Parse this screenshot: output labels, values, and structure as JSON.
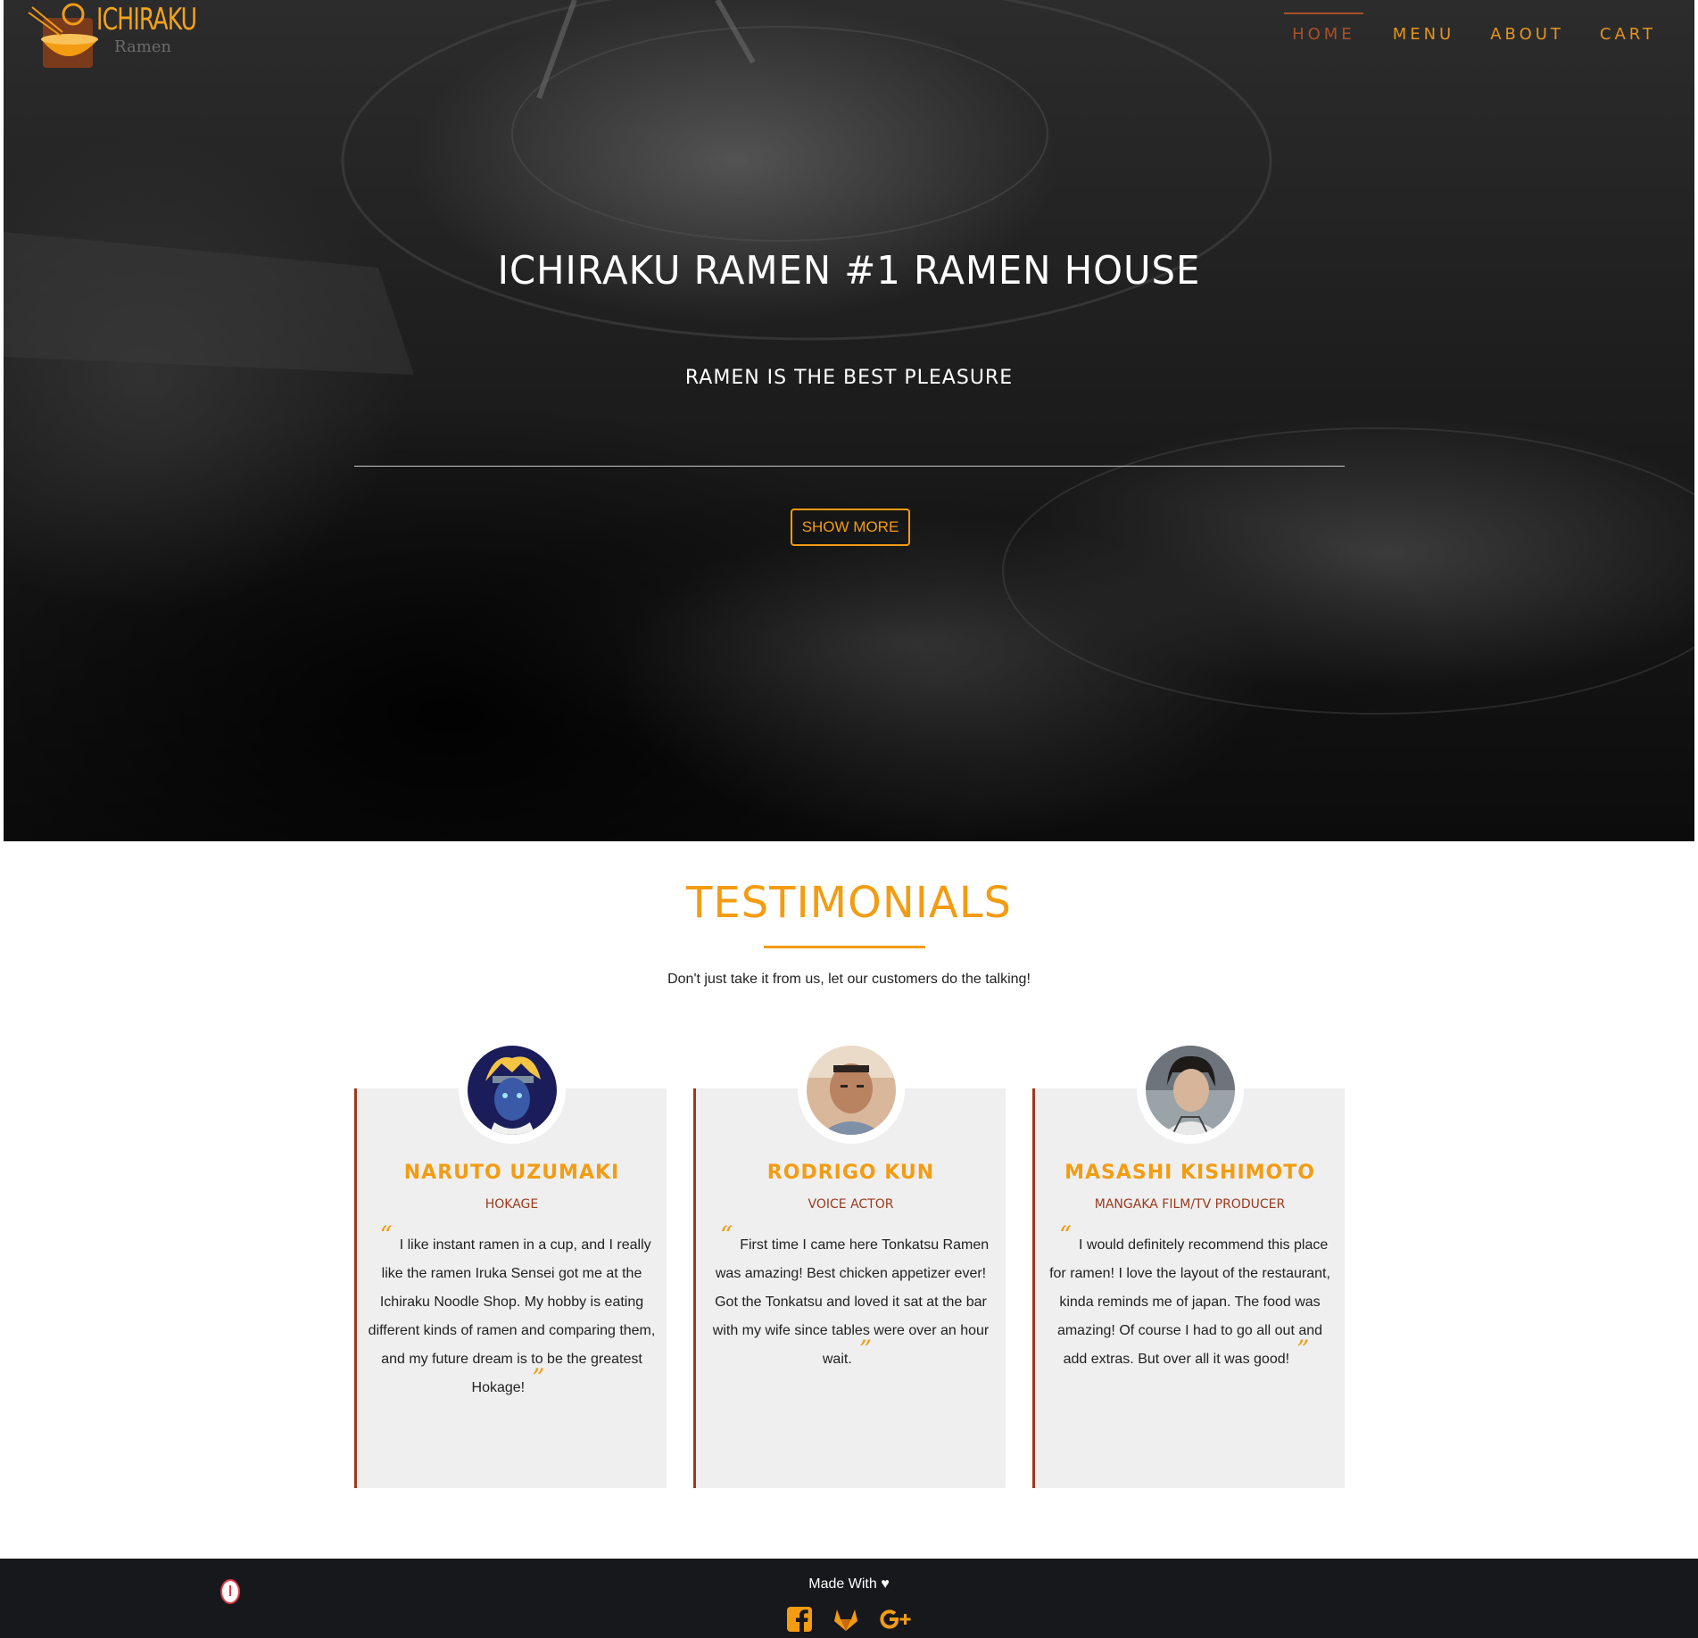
{
  "brand": {
    "name": "ICHIRAKU",
    "sub": "Ramen",
    "accent_color": "#f39c12",
    "secondary_color": "#9b3a1c"
  },
  "nav": {
    "items": [
      {
        "label": "HOME",
        "active": true
      },
      {
        "label": "MENU",
        "active": false
      },
      {
        "label": "ABOUT",
        "active": false
      },
      {
        "label": "CART",
        "active": false
      }
    ]
  },
  "hero": {
    "title": "ICHIRAKU RAMEN #1 RAMEN HOUSE",
    "subtitle": "RAMEN IS THE BEST PLEASURE",
    "button_label": "SHOW MORE"
  },
  "testimonials": {
    "title": "TESTIMONIALS",
    "subtitle": "Don't just take it from us, let our customers do the talking!",
    "cards": [
      {
        "name": "NARUTO UZUMAKI",
        "role": "HOKAGE",
        "quote": "I like instant ramen in a cup, and I really like the ramen Iruka Sensei got me at the Ichiraku Noodle Shop. My hobby is eating different kinds of ramen and comparing them, and my future dream is to be the greatest Hokage!",
        "avatar_icon": "naruto-avatar"
      },
      {
        "name": "RODRIGO KUN",
        "role": "VOICE ACTOR",
        "quote": "First time I came here Tonkatsu Ramen was amazing! Best chicken appetizer ever! Got the Tonkatsu and loved it sat at the bar with my wife since tables were over an hour wait.",
        "avatar_icon": "rodrigo-avatar"
      },
      {
        "name": "MASASHI KISHIMOTO",
        "role": "MANGAKA FILM/TV PRODUCER",
        "quote": "I would definitely recommend this place for ramen! I love the layout of the restaurant, kinda reminds me of japan. The food was amazing! Of course I had to go all out and add extras. But over all it was good!",
        "avatar_icon": "masashi-avatar"
      }
    ]
  },
  "footer": {
    "text": "Made With ♥",
    "icons": [
      "facebook-icon",
      "gitlab-icon",
      "google-plus-icon"
    ]
  }
}
